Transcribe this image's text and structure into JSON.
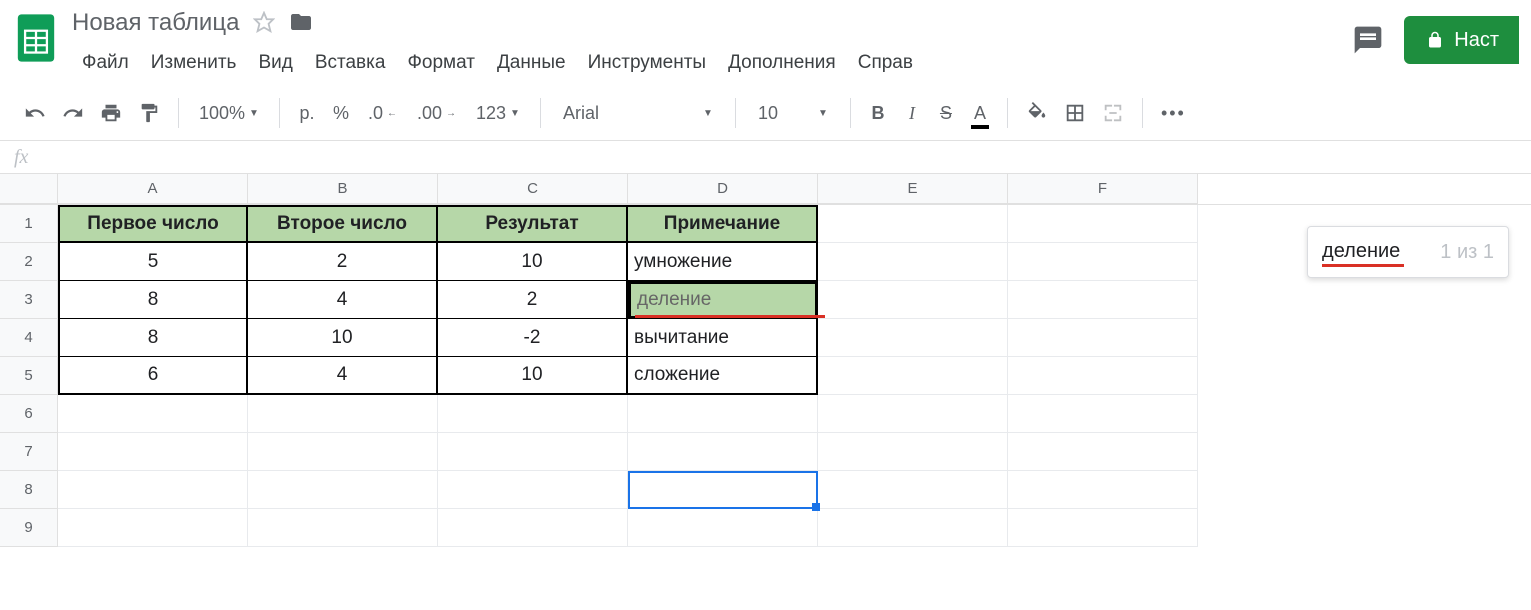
{
  "doc": {
    "title": "Новая таблица"
  },
  "menus": [
    "Файл",
    "Изменить",
    "Вид",
    "Вставка",
    "Формат",
    "Данные",
    "Инструменты",
    "Дополнения",
    "Справ"
  ],
  "share_label": "Наст",
  "toolbar": {
    "zoom": "100%",
    "currency": "р.",
    "percent": "%",
    "dec_less": ".0",
    "dec_more": ".00",
    "num_fmt": "123",
    "font": "Arial",
    "size": "10",
    "bold": "B",
    "italic": "I",
    "strike": "S",
    "text_color": "A"
  },
  "columns": [
    {
      "label": "A",
      "width": 190
    },
    {
      "label": "B",
      "width": 190
    },
    {
      "label": "C",
      "width": 190
    },
    {
      "label": "D",
      "width": 190
    },
    {
      "label": "E",
      "width": 190
    },
    {
      "label": "F",
      "width": 190
    }
  ],
  "row_count": 9,
  "table": {
    "headers": [
      "Первое число",
      "Второе число",
      "Результат",
      "Примечание"
    ],
    "rows": [
      {
        "a": "5",
        "b": "2",
        "c": "10",
        "d": "умножение"
      },
      {
        "a": "8",
        "b": "4",
        "c": "2",
        "d": "деление"
      },
      {
        "a": "8",
        "b": "10",
        "c": "-2",
        "d": "вычитание"
      },
      {
        "a": "6",
        "b": "4",
        "c": "10",
        "d": "сложение"
      }
    ]
  },
  "find": {
    "term": "деление",
    "count": "1 из 1"
  },
  "selected_cell": {
    "row": 8,
    "col": "D"
  }
}
